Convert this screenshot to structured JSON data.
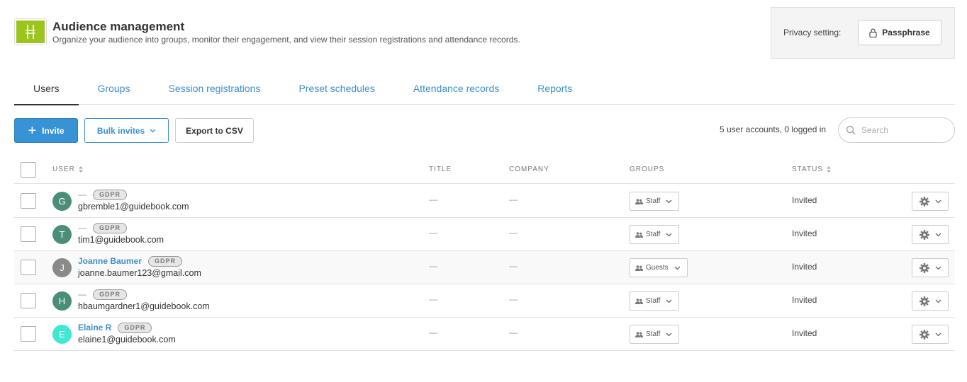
{
  "header": {
    "title": "Audience management",
    "subtitle": "Organize your audience into groups, monitor their engagement,  and view their session registrations and attendance records.",
    "logo_icon": "guidebook-logo-icon",
    "logo_color": "#9cc31e"
  },
  "privacy": {
    "label": "Privacy setting:",
    "button_label": "Passphrase",
    "icon": "lock-icon"
  },
  "tabs": [
    {
      "label": "Users",
      "active": true
    },
    {
      "label": "Groups",
      "active": false
    },
    {
      "label": "Session registrations",
      "active": false
    },
    {
      "label": "Preset schedules",
      "active": false
    },
    {
      "label": "Attendance records",
      "active": false
    },
    {
      "label": "Reports",
      "active": false
    }
  ],
  "toolbar": {
    "invite_label": "Invite",
    "bulk_invites_label": "Bulk invites",
    "export_label": "Export to CSV",
    "accounts_summary": "5 user accounts, 0 logged in",
    "search_placeholder": "Search"
  },
  "table": {
    "columns": {
      "user": "USER",
      "title": "TITLE",
      "company": "COMPANY",
      "groups": "GROUPS",
      "status": "STATUS"
    },
    "rows": [
      {
        "initial": "G",
        "avatar_color": "#4a8e7a",
        "name": "—",
        "name_is_link": false,
        "badge": "GDPR",
        "email": "gbremble1@guidebook.com",
        "title": "—",
        "company": "—",
        "group": "Staff",
        "status": "Invited"
      },
      {
        "initial": "T",
        "avatar_color": "#4a8e7a",
        "name": "—",
        "name_is_link": false,
        "badge": "GDPR",
        "email": "tim1@guidebook.com",
        "title": "—",
        "company": "—",
        "group": "Staff",
        "status": "Invited"
      },
      {
        "initial": "J",
        "avatar_color": "#8a8a8a",
        "name": "Joanne Baumer",
        "name_is_link": true,
        "badge": "GDPR",
        "email": "joanne.baumer123@gmail.com",
        "title": "—",
        "company": "—",
        "group": "Guests",
        "status": "Invited"
      },
      {
        "initial": "H",
        "avatar_color": "#4a8e7a",
        "name": "—",
        "name_is_link": false,
        "badge": "GDPR",
        "email": "hbaumgardner1@guidebook.com",
        "title": "—",
        "company": "—",
        "group": "Staff",
        "status": "Invited"
      },
      {
        "initial": "E",
        "avatar_color": "#3ee8d2",
        "name": "Elaine R",
        "name_is_link": true,
        "badge": "GDPR",
        "email": "elaine1@guidebook.com",
        "title": "—",
        "company": "—",
        "group": "Staff",
        "status": "Invited"
      }
    ]
  },
  "colors": {
    "accent": "#3793d5",
    "link": "#3d8fcc"
  }
}
